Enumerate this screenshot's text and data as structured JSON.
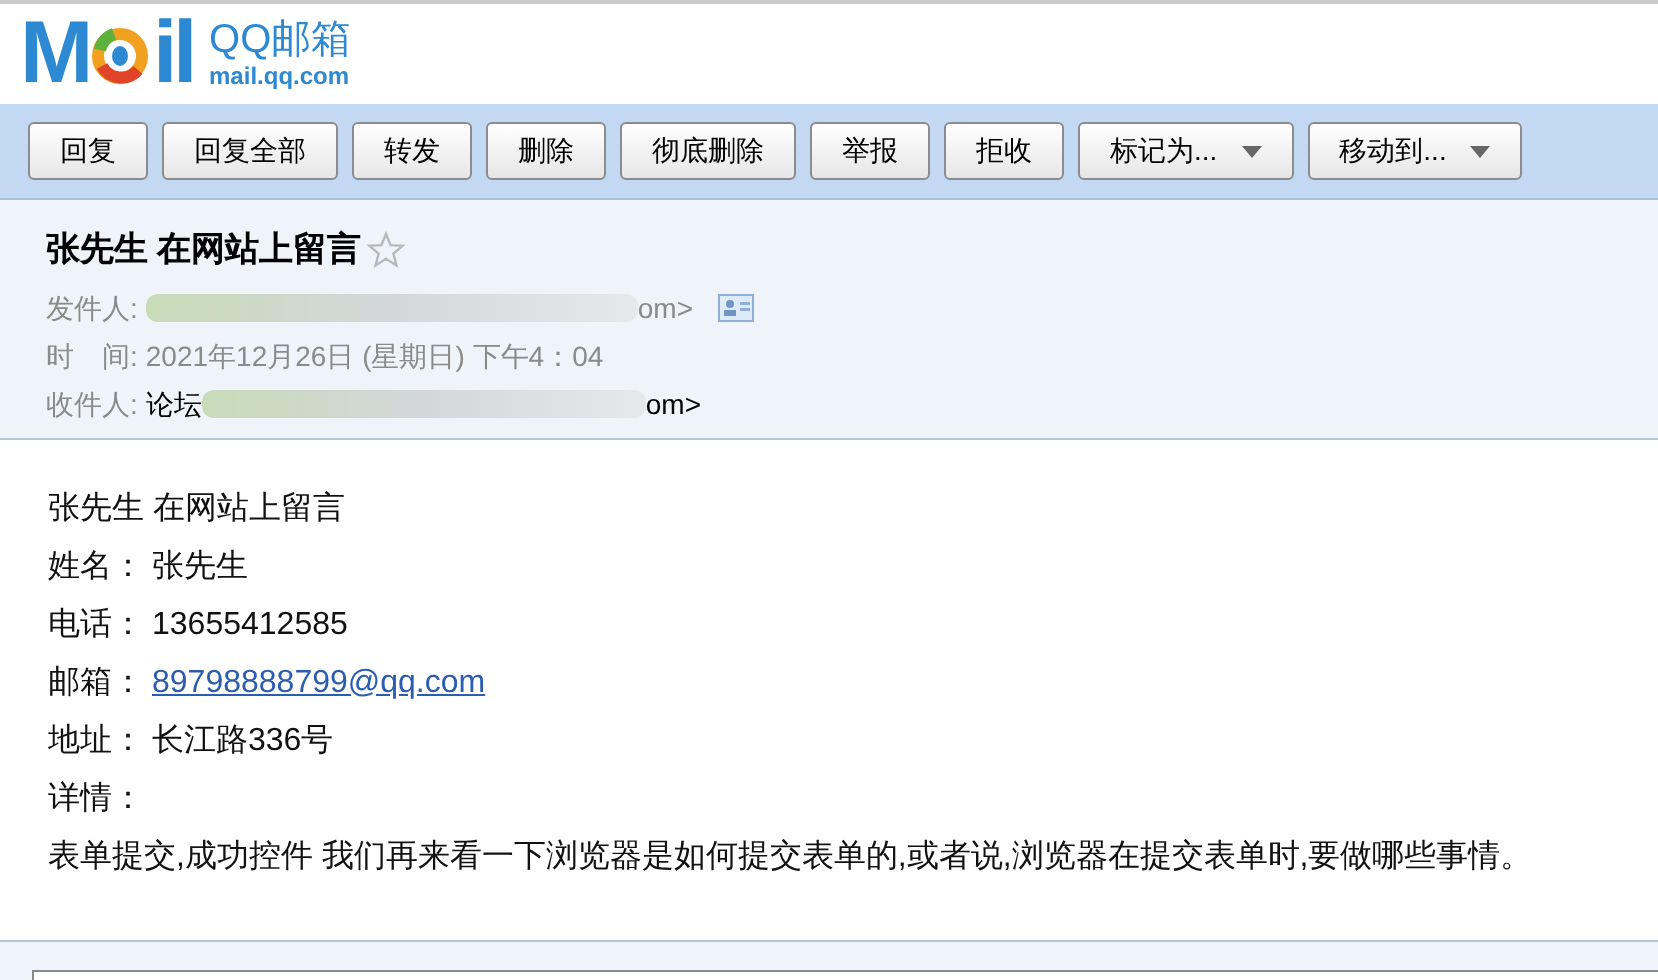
{
  "logo": {
    "mark_start": "M",
    "mark_end": "il",
    "name": "QQ邮箱",
    "domain": "mail.qq.com"
  },
  "toolbar": [
    {
      "label": "回复",
      "kind": "button"
    },
    {
      "label": "回复全部",
      "kind": "button"
    },
    {
      "label": "转发",
      "kind": "button"
    },
    {
      "label": "删除",
      "kind": "button"
    },
    {
      "label": "彻底删除",
      "kind": "button"
    },
    {
      "label": "举报",
      "kind": "button"
    },
    {
      "label": "拒收",
      "kind": "button"
    },
    {
      "label": "标记为...",
      "kind": "dropdown"
    },
    {
      "label": "移动到...",
      "kind": "dropdown"
    }
  ],
  "header": {
    "subject": "张先生 在网站上留言",
    "starred": false,
    "fields": [
      {
        "label": "发件人:",
        "suffix": "om>",
        "redacted": true,
        "kind": "contact"
      },
      {
        "label": "时　间:",
        "prefix": "2021年12月26日 (星期日) 下午4：04",
        "redacted": false,
        "kind": "plain"
      },
      {
        "label": "收件人:",
        "prefix": "论坛",
        "suffix": "om>",
        "redacted": true,
        "kind": "plain"
      }
    ]
  },
  "body": [
    {
      "value": "张先生 在网站上留言",
      "kind": "text"
    },
    {
      "label": "姓名：",
      "value": "张先生",
      "kind": "text"
    },
    {
      "label": "电话：",
      "value": "13655412585",
      "kind": "text"
    },
    {
      "label": "邮箱：",
      "value": "89798888799@qq.com",
      "kind": "link"
    },
    {
      "label": "地址：",
      "value": "长江路336号",
      "kind": "text"
    },
    {
      "label": "详情："
    },
    {
      "value": "表单提交,成功控件 我们再来看一下浏览器是如何提交表单的,或者说,浏览器在提交表单时,要做哪些事情。",
      "kind": "text"
    }
  ]
}
